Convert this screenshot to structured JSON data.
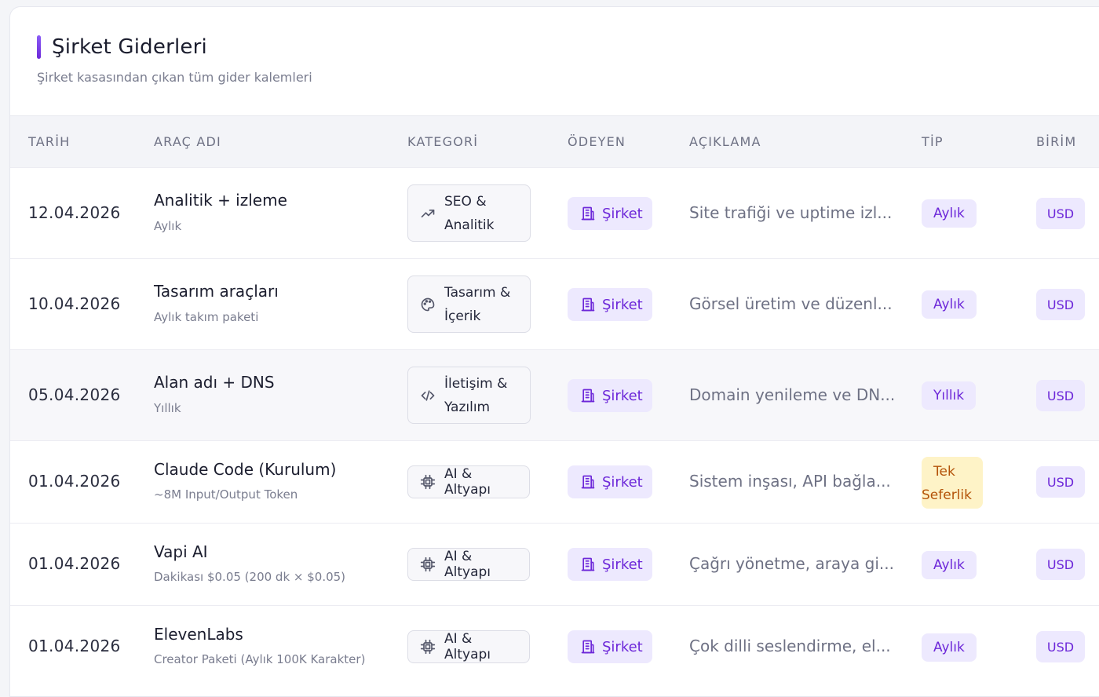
{
  "header": {
    "title": "Şirket Giderleri",
    "subtitle": "Şirket kasasından çıkan tüm gider kalemleri"
  },
  "columns": [
    "TARİH",
    "ARAÇ ADI",
    "KATEGORİ",
    "ÖDEYEN",
    "AÇIKLAMA",
    "TİP",
    "BİRİM"
  ],
  "rows": [
    {
      "date": "12.04.2026",
      "name": "Analitik + izleme",
      "sub": "Aylık",
      "cat1": "SEO &",
      "cat2": "Analitik",
      "cat_icon": "trending-up-icon",
      "payer": "Şirket",
      "desc": "Site trafiği ve uptime izl...",
      "tip": "Aylık",
      "unit": "USD"
    },
    {
      "date": "10.04.2026",
      "name": "Tasarım araçları",
      "sub": "Aylık takım paketi",
      "cat1": "Tasarım &",
      "cat2": "İçerik",
      "cat_icon": "palette-icon",
      "payer": "Şirket",
      "desc": "Görsel üretim ve düzenl...",
      "tip": "Aylık",
      "unit": "USD"
    },
    {
      "date": "05.04.2026",
      "name": "Alan adı + DNS",
      "sub": "Yıllık",
      "cat1": "İletişim &",
      "cat2": "Yazılım",
      "cat_icon": "code-icon",
      "payer": "Şirket",
      "desc": "Domain yenileme ve DN...",
      "tip": "Yıllık",
      "unit": "USD"
    },
    {
      "date": "01.04.2026",
      "name": "Claude Code (Kurulum)",
      "sub": "~8M Input/Output Token",
      "cat1": "AI & Altyapı",
      "cat_icon": "cpu-icon",
      "payer": "Şirket",
      "desc": "Sistem inşası, API bağla...",
      "tip1": "Tek",
      "tip2": "Seferlik",
      "unit": "USD"
    },
    {
      "date": "01.04.2026",
      "name": "Vapi AI",
      "sub": "Dakikası $0.05 (200 dk × $0.05)",
      "cat1": "AI & Altyapı",
      "cat_icon": "cpu-icon",
      "payer": "Şirket",
      "desc": "Çağrı yönetme, araya gi...",
      "tip": "Aylık",
      "unit": "USD"
    },
    {
      "date": "01.04.2026",
      "name": "ElevenLabs",
      "sub": "Creator Paketi (Aylık 100K Karakter)",
      "cat1": "AI & Altyapı",
      "cat_icon": "cpu-icon",
      "payer": "Şirket",
      "desc": "Çok dilli seslendirme, el...",
      "tip": "Aylık",
      "unit": "USD"
    }
  ],
  "colors": {
    "accent": "#6d28d9",
    "accent_bg": "#ede9fe",
    "once_bg": "#fef3c7",
    "once_fg": "#b45309"
  }
}
